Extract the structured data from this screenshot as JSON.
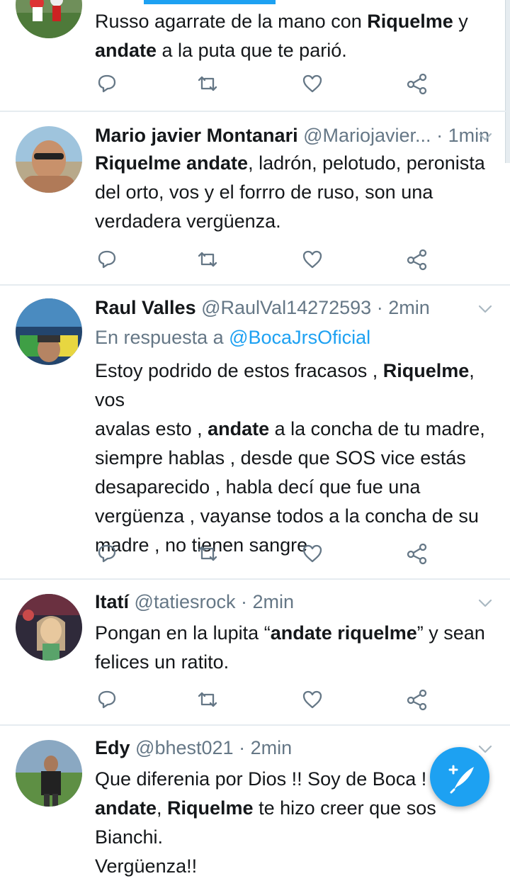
{
  "tweets": [
    {
      "lines": [
        [
          {
            "t": "Russo agarrate de la mano con ",
            "b": false
          },
          {
            "t": "Riquelme",
            "b": true
          },
          {
            "t": " y",
            "b": false
          }
        ],
        [
          {
            "t": "andate",
            "b": true
          },
          {
            "t": " a la puta que te parió.",
            "b": false
          }
        ]
      ]
    },
    {
      "name": "Mario javier Montanari",
      "handle": "@Mariojavier...",
      "time": "· 1min",
      "lines": [
        [
          {
            "t": "Riquelme andate",
            "b": true
          },
          {
            "t": ", ladrón, pelotudo, peronista",
            "b": false
          }
        ],
        [
          {
            "t": "del orto, vos y el forrro de ruso, son una",
            "b": false
          }
        ],
        [
          {
            "t": "verdadera vergüenza.",
            "b": false
          }
        ]
      ]
    },
    {
      "name": "Raul Valles",
      "handle": "@RaulVal14272593",
      "time": "· 2min",
      "reply_prefix": "En respuesta a ",
      "reply_handle": "@BocaJrsOficial",
      "lines": [
        [
          {
            "t": "Estoy podrido de estos fracasos , ",
            "b": false
          },
          {
            "t": "Riquelme",
            "b": true
          },
          {
            "t": ", vos",
            "b": false
          }
        ],
        [
          {
            "t": "avalas esto , ",
            "b": false
          },
          {
            "t": "andate",
            "b": true
          },
          {
            "t": " a la concha de tu madre,",
            "b": false
          }
        ],
        [
          {
            "t": "siempre hablas , desde que SOS vice estás",
            "b": false
          }
        ],
        [
          {
            "t": "desaparecido , habla decí que fue una",
            "b": false
          }
        ],
        [
          {
            "t": "vergüenza , vayanse todos a la concha de su",
            "b": false
          }
        ],
        [
          {
            "t": "madre , no tienen sangre",
            "b": false
          }
        ]
      ]
    },
    {
      "name": "Itatí",
      "handle": "@tatiesrock",
      "time": "· 2min",
      "lines": [
        [
          {
            "t": "Pongan en la lupita “",
            "b": false
          },
          {
            "t": "andate riquelme",
            "b": true
          },
          {
            "t": "” y sean",
            "b": false
          }
        ],
        [
          {
            "t": "felices un ratito.",
            "b": false
          }
        ]
      ]
    },
    {
      "name": "Edy",
      "handle": "@bhest021",
      "time": "· 2min",
      "lines": [
        [
          {
            "t": "Que diferenia por Dios !! Soy de Boca ! R",
            "b": false
          }
        ],
        [
          {
            "t": "andate",
            "b": true
          },
          {
            "t": ", ",
            "b": false
          },
          {
            "t": "Riquelme",
            "b": true
          },
          {
            "t": " te hizo creer que sos Bianchi.",
            "b": false
          }
        ],
        [
          {
            "t": "Vergüenza!!",
            "b": false
          }
        ]
      ]
    }
  ],
  "icons": {
    "reply": "reply-icon",
    "retweet": "retweet-icon",
    "like": "heart-icon",
    "share": "share-icon",
    "chevron": "chevron-down-icon",
    "compose": "compose-tweet-icon"
  },
  "colors": {
    "accent": "#1da1f2",
    "text": "#14171a",
    "muted": "#657786",
    "divider": "#e6ecf0"
  }
}
